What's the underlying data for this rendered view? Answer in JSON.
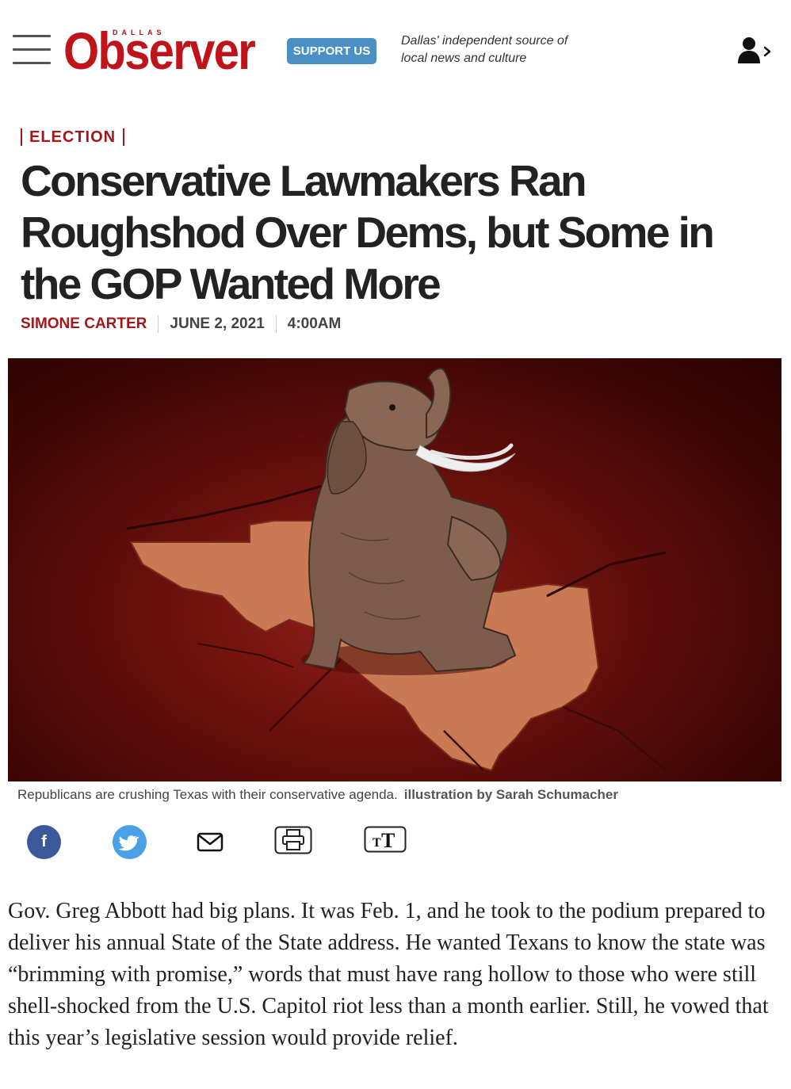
{
  "header": {
    "logo_small": "DALLAS",
    "logo_name": "Observer",
    "support_label": "SUPPORT US",
    "tagline_line1": "Dallas' independent source of",
    "tagline_line2": "local news and culture"
  },
  "article": {
    "section": "ELECTION",
    "headline": "Conservative Lawmakers Ran Roughshod Over Dems, but Some in the GOP Wanted More",
    "author": "SIMONE CARTER",
    "date": "JUNE 2, 2021",
    "time": "4:00AM",
    "caption": "Republicans are crushing Texas with their conservative agenda.",
    "credit": "illustration by Sarah Schumacher",
    "body": "Gov. Greg Abbott had big plans. It was Feb. 1, and he took to the podium prepared to deliver his annual State of the State address. He wanted Texans to know the state was “brimming with promise,” words that must have rang hollow to those who were still shell-shocked from the U.S. Capitol riot less than a month earlier. Still, he vowed that this year’s legislative session would provide relief."
  },
  "share": {
    "facebook_glyph": "f",
    "icons": [
      "facebook-icon",
      "twitter-icon",
      "email-icon",
      "print-icon",
      "text-size-icon"
    ]
  },
  "colors": {
    "brand_red": "#c0141b",
    "section_red": "#a4161a",
    "support_blue": "#4a90c4",
    "facebook_blue": "#3b5998",
    "twitter_blue": "#4aa1e8"
  }
}
